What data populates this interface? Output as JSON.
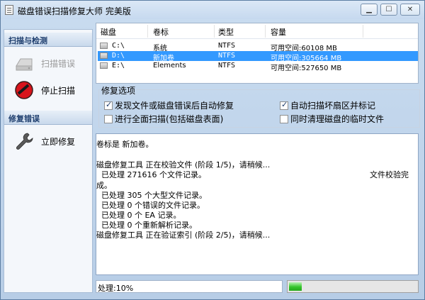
{
  "window": {
    "title": "磁盘错误扫描修复大师 完美版",
    "controls": {
      "minimize_icon": "minimize-icon",
      "maximize_icon": "maximize-icon",
      "close_icon": "close-icon"
    }
  },
  "sidebar": {
    "scan_section": "扫描与检测",
    "scan_button": "扫描错误",
    "scan_button_enabled": false,
    "stop_button": "停止扫描",
    "repair_section": "修复错误",
    "repair_button": "立即修复"
  },
  "drives": {
    "columns": [
      "磁盘",
      "卷标",
      "类型",
      "容量"
    ],
    "rows": [
      {
        "disk": "C:\\",
        "label": "系统",
        "type": "NTFS",
        "capacity": "可用空间:60108 MB",
        "selected": false
      },
      {
        "disk": "D:\\",
        "label": "新加卷",
        "type": "NTFS",
        "capacity": "可用空间:305664 MB",
        "selected": true
      },
      {
        "disk": "E:\\",
        "label": "Elements",
        "type": "NTFS",
        "capacity": "可用空间:527650 MB",
        "selected": false
      }
    ]
  },
  "options": {
    "title": "修复选项",
    "items": [
      {
        "label": "发现文件或磁盘错误后自动修复",
        "checked": true
      },
      {
        "label": "自动扫描坏扇区并标记",
        "checked": true
      },
      {
        "label": "进行全面扫描(包括磁盘表面)",
        "checked": false
      },
      {
        "label": "同时清理磁盘的临时文件",
        "checked": false
      }
    ]
  },
  "log": {
    "lines": [
      "卷标是 新加卷。",
      "",
      "磁盘修复工具 正在校验文件 (阶段 1/5)，请稍候...",
      "  已处理 271616 个文件记录。",
      "成。",
      "  已处理 305 个大型文件记录。",
      "  已处理 0 个错误的文件记录。",
      "  已处理 0 个 EA 记录。",
      "  已处理 0 个重新解析记录。",
      "磁盘修复工具 正在验证索引 (阶段 2/5)，请稍候..."
    ],
    "floating_text": "文件校验完"
  },
  "status": {
    "text": "处理:10%",
    "progress_percent": 10,
    "progress_color": "#35c42a"
  }
}
